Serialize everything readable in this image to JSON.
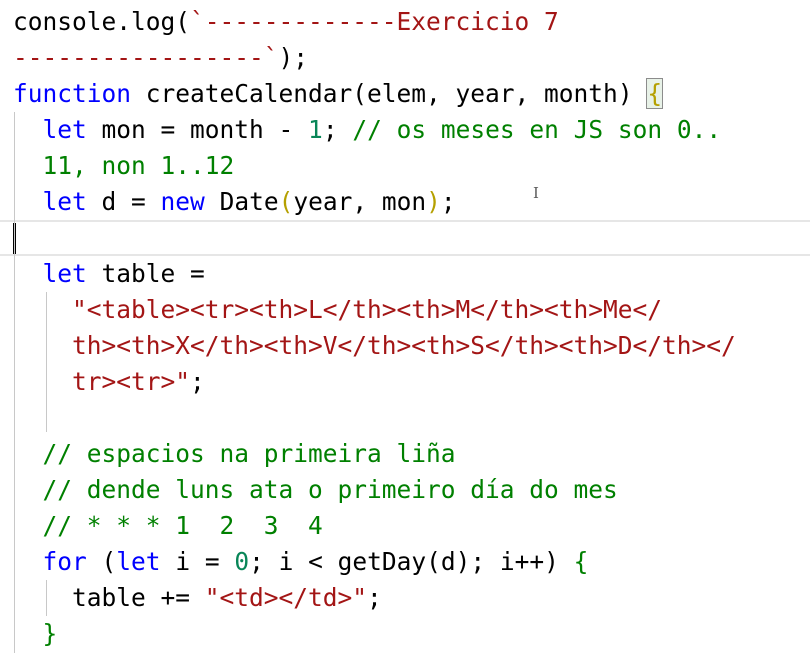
{
  "editor": {
    "colors": {
      "default": "#000000",
      "keyword": "#0000ff",
      "string": "#a31515",
      "comment": "#008000",
      "number": "#098658",
      "bracket": "#b5a000"
    },
    "lines": [
      [
        {
          "t": "console.log(",
          "c": "default"
        },
        {
          "t": "`-------------Exercicio 7",
          "c": "string"
        }
      ],
      [
        {
          "t": "-----------------`",
          "c": "string"
        },
        {
          "t": ");",
          "c": "default"
        }
      ],
      [
        {
          "t": "function",
          "c": "keyword"
        },
        {
          "t": " createCalendar",
          "c": "default"
        },
        {
          "t": "(",
          "c": "default"
        },
        {
          "t": "elem, year, month",
          "c": "default"
        },
        {
          "t": ")",
          "c": "default"
        },
        {
          "t": " ",
          "c": "default"
        },
        {
          "t": "{",
          "c": "brace-match"
        }
      ],
      [
        {
          "t": "  ",
          "c": "default"
        },
        {
          "t": "let",
          "c": "keyword"
        },
        {
          "t": " mon = month - ",
          "c": "default"
        },
        {
          "t": "1",
          "c": "number"
        },
        {
          "t": "; ",
          "c": "default"
        },
        {
          "t": "// os meses en JS son 0..",
          "c": "comment"
        }
      ],
      [
        {
          "t": "  11, non 1..12",
          "c": "comment"
        }
      ],
      [
        {
          "t": "  ",
          "c": "default"
        },
        {
          "t": "let",
          "c": "keyword"
        },
        {
          "t": " d = ",
          "c": "default"
        },
        {
          "t": "new",
          "c": "keyword"
        },
        {
          "t": " Date",
          "c": "default"
        },
        {
          "t": "(",
          "c": "bracket"
        },
        {
          "t": "year, mon",
          "c": "default"
        },
        {
          "t": ")",
          "c": "bracket"
        },
        {
          "t": ";",
          "c": "default"
        }
      ],
      [
        {
          "t": "",
          "c": "default"
        }
      ],
      [
        {
          "t": "  ",
          "c": "default"
        },
        {
          "t": "let",
          "c": "keyword"
        },
        {
          "t": " table =",
          "c": "default"
        }
      ],
      [
        {
          "t": "    ",
          "c": "default"
        },
        {
          "t": "\"<table><tr><th>L</th><th>M</th><th>Me</",
          "c": "string"
        }
      ],
      [
        {
          "t": "    ",
          "c": "default"
        },
        {
          "t": "th><th>X</th><th>V</th><th>S</th><th>D</th></",
          "c": "string"
        }
      ],
      [
        {
          "t": "    ",
          "c": "default"
        },
        {
          "t": "tr><tr>\"",
          "c": "string"
        },
        {
          "t": ";",
          "c": "default"
        }
      ],
      [
        {
          "t": "",
          "c": "default"
        }
      ],
      [
        {
          "t": "  ",
          "c": "default"
        },
        {
          "t": "// espacios na primeira liña",
          "c": "comment"
        }
      ],
      [
        {
          "t": "  ",
          "c": "default"
        },
        {
          "t": "// dende luns ata o primeiro día do mes",
          "c": "comment"
        }
      ],
      [
        {
          "t": "  ",
          "c": "default"
        },
        {
          "t": "// * * * 1  2  3  4",
          "c": "comment"
        }
      ],
      [
        {
          "t": "  ",
          "c": "default"
        },
        {
          "t": "for",
          "c": "keyword"
        },
        {
          "t": " (",
          "c": "default"
        },
        {
          "t": "let",
          "c": "keyword"
        },
        {
          "t": " i = ",
          "c": "default"
        },
        {
          "t": "0",
          "c": "number"
        },
        {
          "t": "; i < getDay",
          "c": "default"
        },
        {
          "t": "(",
          "c": "default"
        },
        {
          "t": "d",
          "c": "default"
        },
        {
          "t": ")",
          "c": "default"
        },
        {
          "t": "; i++) ",
          "c": "default"
        },
        {
          "t": "{",
          "c": "comment"
        }
      ],
      [
        {
          "t": "    ",
          "c": "default"
        },
        {
          "t": "table += ",
          "c": "default"
        },
        {
          "t": "\"<td></td>\"",
          "c": "string"
        },
        {
          "t": ";",
          "c": "default"
        }
      ],
      [
        {
          "t": "  ",
          "c": "default"
        },
        {
          "t": "}",
          "c": "comment"
        }
      ]
    ]
  }
}
